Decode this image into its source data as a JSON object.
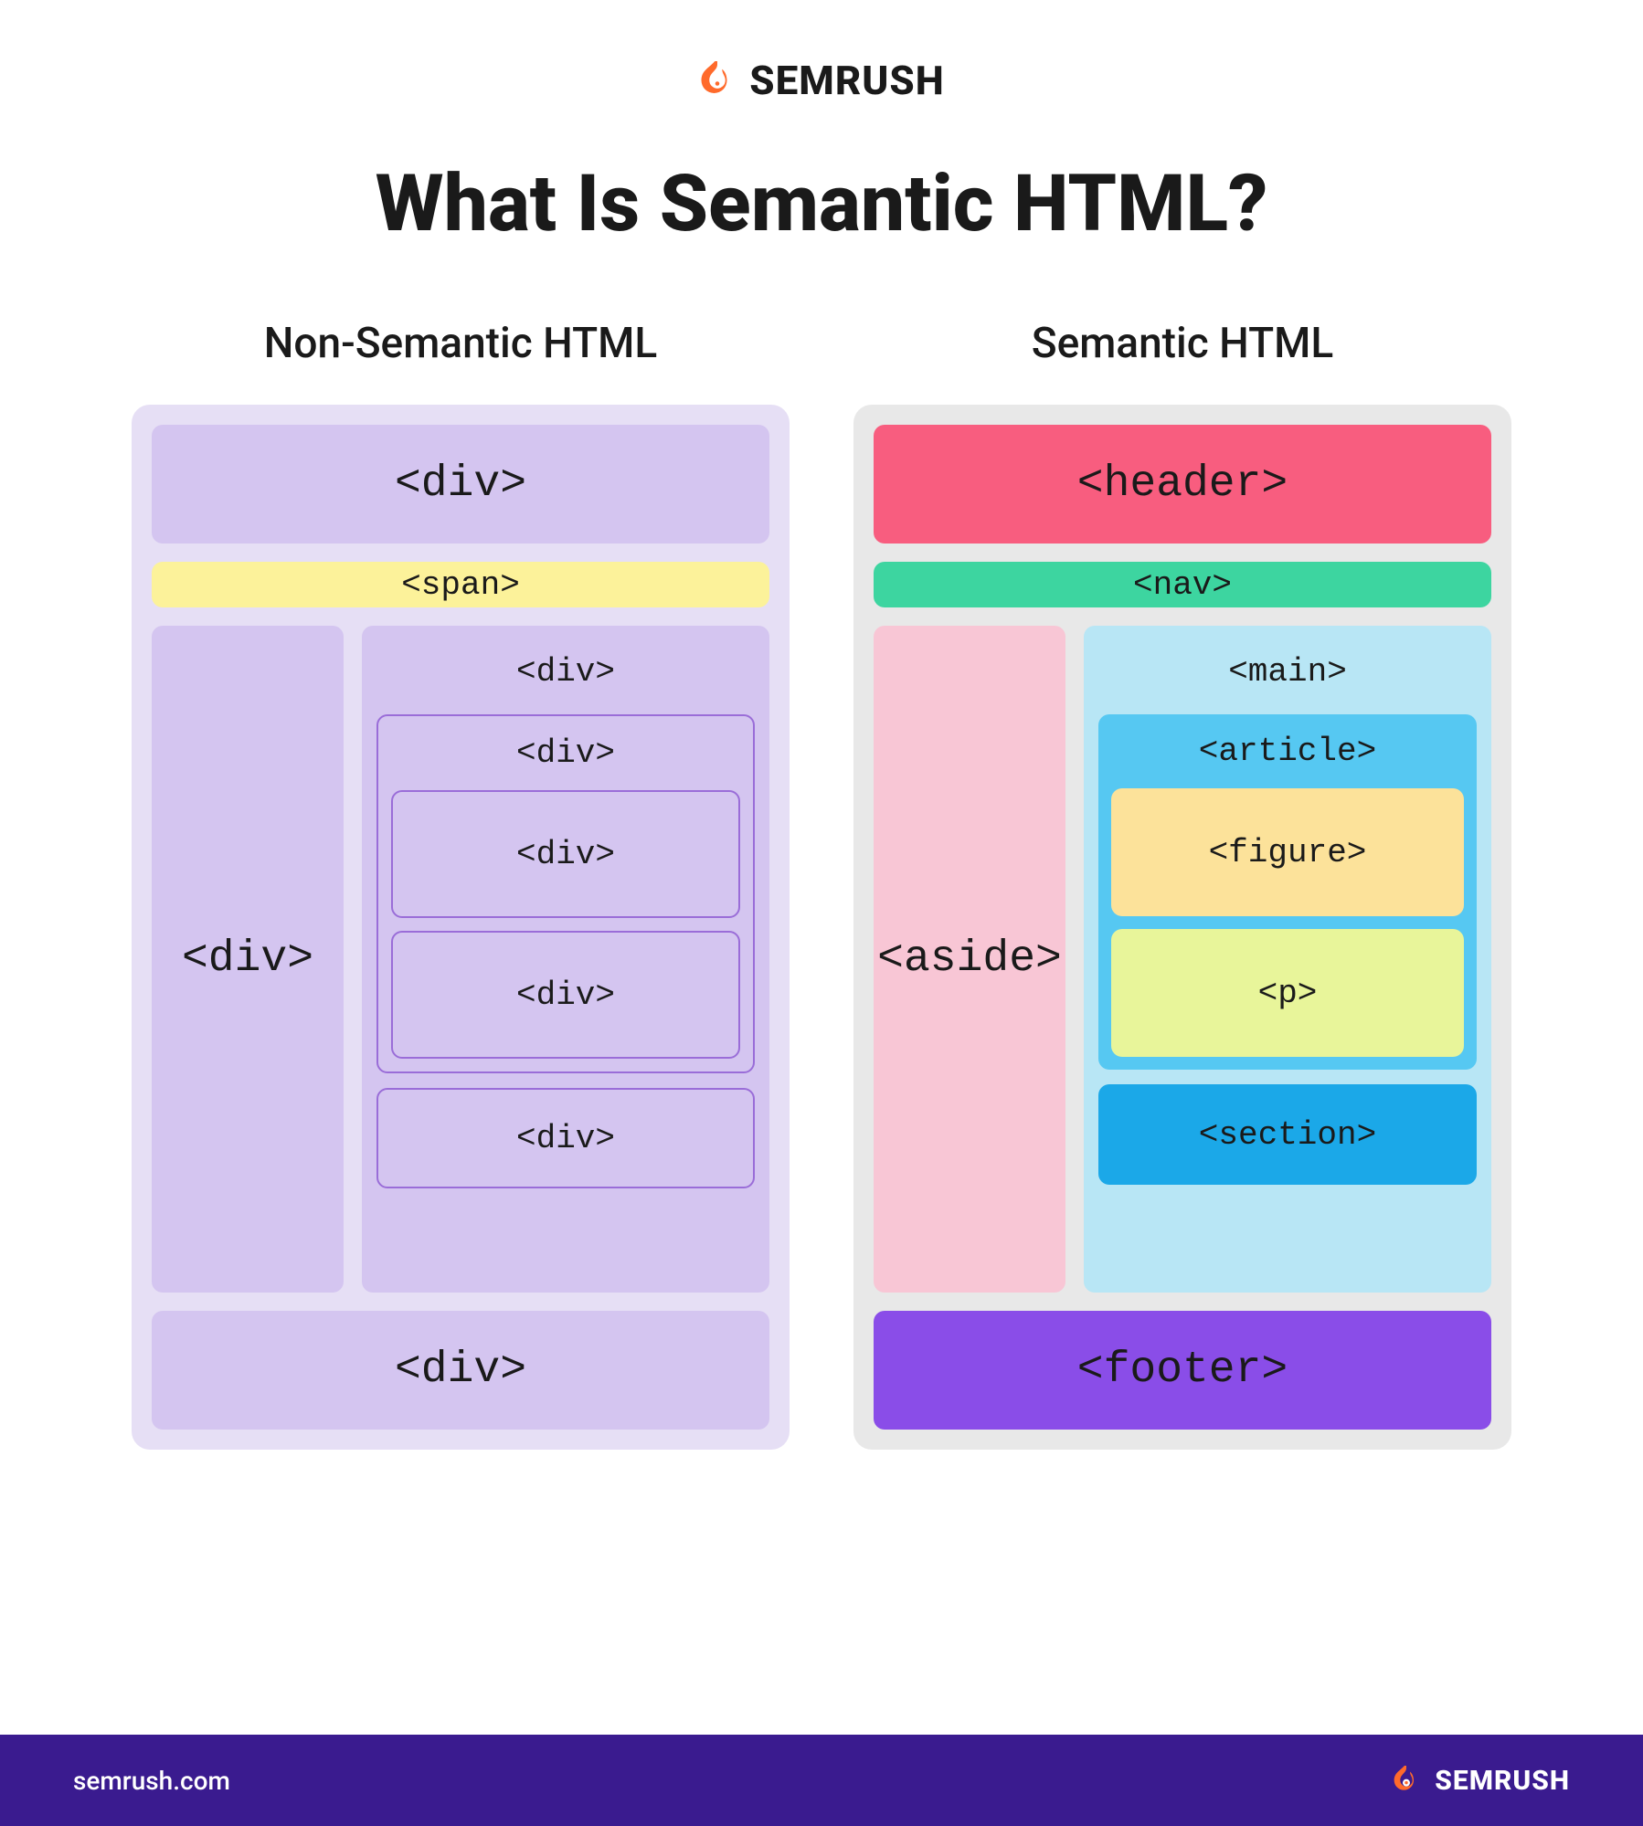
{
  "brand": {
    "name": "SEMRUSH",
    "url": "semrush.com"
  },
  "title": "What Is Semantic HTML?",
  "left": {
    "heading": "Non-Semantic HTML",
    "header_block": "<div>",
    "nav_block": "<span>",
    "aside_block": "<div>",
    "main_block": "<div>",
    "article_block": "<div>",
    "figure_block": "<div>",
    "p_block": "<div>",
    "section_block": "<div>",
    "footer_block": "<div>"
  },
  "right": {
    "heading": "Semantic HTML",
    "header_block": "<header>",
    "nav_block": "<nav>",
    "aside_block": "<aside>",
    "main_block": "<main>",
    "article_block": "<article>",
    "figure_block": "<figure>",
    "p_block": "<p>",
    "section_block": "<section>",
    "footer_block": "<footer>"
  }
}
